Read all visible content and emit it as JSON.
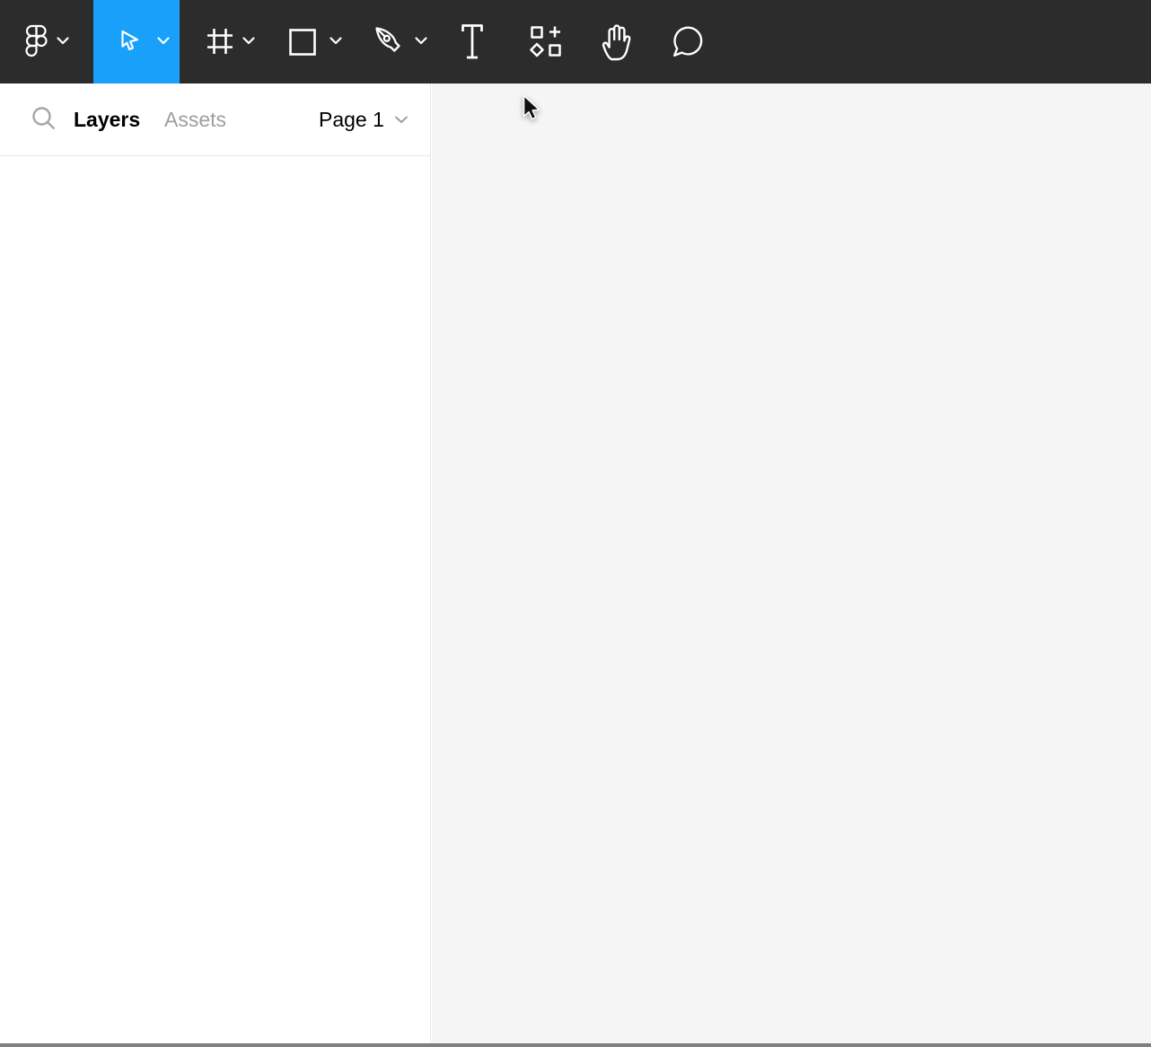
{
  "toolbar": {
    "background": "#2c2c2c",
    "accent": "#18a0fb",
    "tools": [
      {
        "icon": "figma-logo-icon",
        "dropdown": true,
        "selected": false
      },
      {
        "icon": "move-tool-icon",
        "dropdown": true,
        "selected": true
      },
      {
        "icon": "frame-tool-icon",
        "dropdown": true,
        "selected": false
      },
      {
        "icon": "rectangle-tool-icon",
        "dropdown": true,
        "selected": false
      },
      {
        "icon": "pen-tool-icon",
        "dropdown": true,
        "selected": false
      },
      {
        "icon": "text-tool-icon",
        "dropdown": false,
        "selected": false
      },
      {
        "icon": "component-tool-icon",
        "dropdown": false,
        "selected": false
      },
      {
        "icon": "hand-tool-icon",
        "dropdown": false,
        "selected": false
      },
      {
        "icon": "comment-tool-icon",
        "dropdown": false,
        "selected": false
      }
    ]
  },
  "sidebar": {
    "search_icon": "search-icon",
    "tabs": [
      {
        "label": "Layers",
        "active": true
      },
      {
        "label": "Assets",
        "active": false
      }
    ],
    "page_selector": {
      "value": "Page 1"
    },
    "colors": {
      "active_tab": "#000000",
      "inactive_tab": "#9e9e9e",
      "border": "#e6e6e6"
    }
  },
  "canvas": {
    "background": "#f5f5f5",
    "cursor": "arrow-pointer"
  }
}
